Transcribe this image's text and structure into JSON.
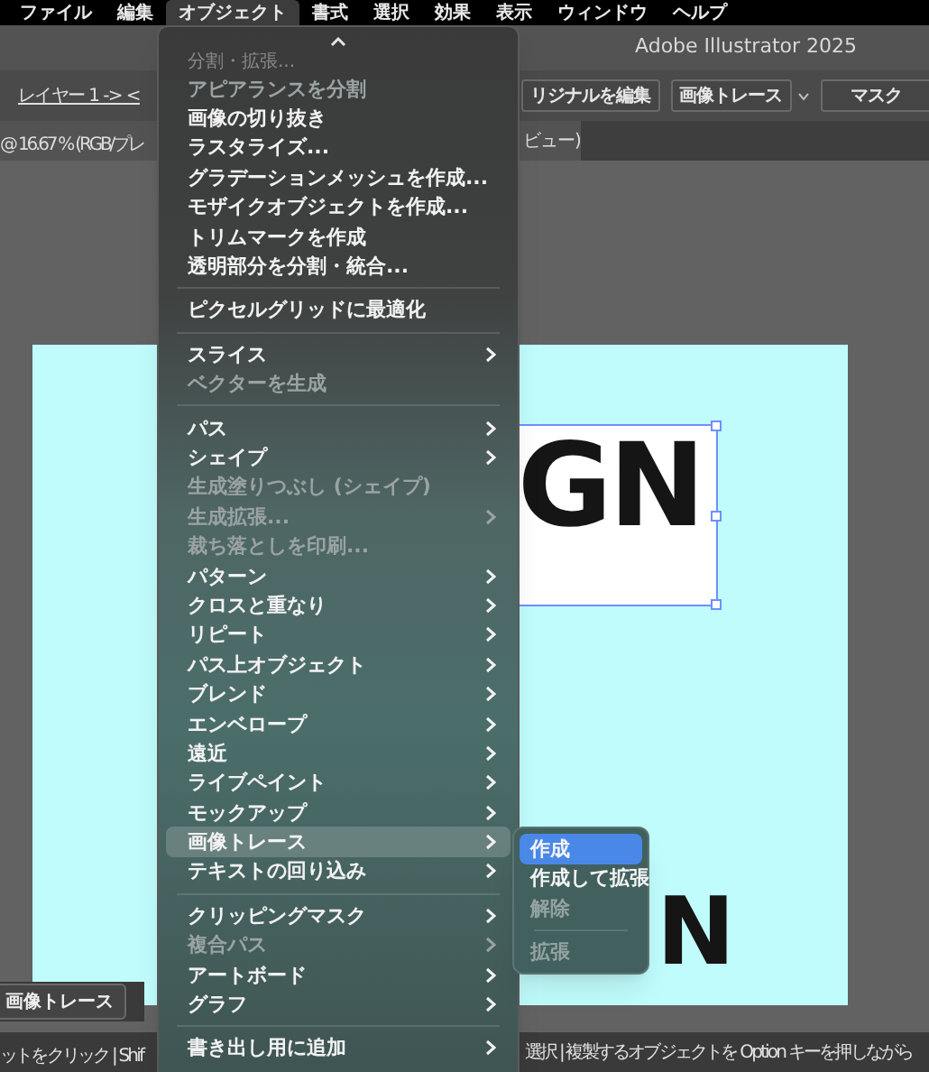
{
  "menu_bar": [
    {
      "label": "ファイル",
      "selected": false
    },
    {
      "label": "編集",
      "selected": false
    },
    {
      "label": "オブジェクト",
      "selected": true
    },
    {
      "label": "書式",
      "selected": false
    },
    {
      "label": "選択",
      "selected": false
    },
    {
      "label": "効果",
      "selected": false
    },
    {
      "label": "表示",
      "selected": false
    },
    {
      "label": "ウィンドウ",
      "selected": false
    },
    {
      "label": "ヘルプ",
      "selected": false
    }
  ],
  "app_title": "Adobe Illustrator 2025",
  "control_bar": {
    "breadcrumb": "レイヤー 1 -> <",
    "buttons": [
      {
        "kind": "button",
        "label": "リジナルを編集"
      },
      {
        "kind": "dropdown",
        "label": "画像トレース"
      },
      {
        "kind": "button",
        "label": "マスク"
      }
    ]
  },
  "document_tab": {
    "left_text": "@ 16.67 % (RGB/プレ",
    "right_text": "ビュー)"
  },
  "artboard": {
    "image_text": "GN",
    "lower_text": "N"
  },
  "floating_bar": {
    "button": "画像トレース"
  },
  "status_bar": {
    "left": "ットをクリック | Shif",
    "right": "選択 | 複製するオブジェクトを Option キーを押しながら"
  },
  "menu": {
    "items": [
      {
        "kind": "clipped",
        "label": "分割・拡張..."
      },
      {
        "kind": "item",
        "label": "アピアランスを分割",
        "disabled": true,
        "submenu": false,
        "selected": false
      },
      {
        "kind": "item",
        "label": "画像の切り抜き",
        "disabled": false,
        "submenu": false,
        "selected": false
      },
      {
        "kind": "item",
        "label": "ラスタライズ...",
        "disabled": false,
        "submenu": false,
        "selected": false
      },
      {
        "kind": "item",
        "label": "グラデーションメッシュを作成...",
        "disabled": false,
        "submenu": false,
        "selected": false
      },
      {
        "kind": "item",
        "label": "モザイクオブジェクトを作成...",
        "disabled": false,
        "submenu": false,
        "selected": false
      },
      {
        "kind": "item",
        "label": "トリムマークを作成",
        "disabled": false,
        "submenu": false,
        "selected": false
      },
      {
        "kind": "item",
        "label": "透明部分を分割・統合...",
        "disabled": false,
        "submenu": false,
        "selected": false
      },
      {
        "kind": "separator"
      },
      {
        "kind": "item",
        "label": "ピクセルグリッドに最適化",
        "disabled": false,
        "submenu": false,
        "selected": false
      },
      {
        "kind": "separator"
      },
      {
        "kind": "item",
        "label": "スライス",
        "disabled": false,
        "submenu": true,
        "selected": false
      },
      {
        "kind": "item",
        "label": "ベクターを生成",
        "disabled": true,
        "submenu": false,
        "selected": false
      },
      {
        "kind": "separator"
      },
      {
        "kind": "item",
        "label": "パス",
        "disabled": false,
        "submenu": true,
        "selected": false
      },
      {
        "kind": "item",
        "label": "シェイプ",
        "disabled": false,
        "submenu": true,
        "selected": false
      },
      {
        "kind": "item",
        "label": "生成塗りつぶし (シェイプ)",
        "disabled": true,
        "submenu": false,
        "selected": false
      },
      {
        "kind": "item",
        "label": "生成拡張...",
        "disabled": true,
        "submenu": true,
        "selected": false
      },
      {
        "kind": "item",
        "label": "裁ち落としを印刷...",
        "disabled": true,
        "submenu": false,
        "selected": false
      },
      {
        "kind": "item",
        "label": "パターン",
        "disabled": false,
        "submenu": true,
        "selected": false
      },
      {
        "kind": "item",
        "label": "クロスと重なり",
        "disabled": false,
        "submenu": true,
        "selected": false
      },
      {
        "kind": "item",
        "label": "リピート",
        "disabled": false,
        "submenu": true,
        "selected": false
      },
      {
        "kind": "item",
        "label": "パス上オブジェクト",
        "disabled": false,
        "submenu": true,
        "selected": false
      },
      {
        "kind": "item",
        "label": "ブレンド",
        "disabled": false,
        "submenu": true,
        "selected": false
      },
      {
        "kind": "item",
        "label": "エンベロープ",
        "disabled": false,
        "submenu": true,
        "selected": false
      },
      {
        "kind": "item",
        "label": "遠近",
        "disabled": false,
        "submenu": true,
        "selected": false
      },
      {
        "kind": "item",
        "label": "ライブペイント",
        "disabled": false,
        "submenu": true,
        "selected": false
      },
      {
        "kind": "item",
        "label": "モックアップ",
        "disabled": false,
        "submenu": true,
        "selected": false
      },
      {
        "kind": "item",
        "label": "画像トレース",
        "disabled": false,
        "submenu": true,
        "selected": true
      },
      {
        "kind": "item",
        "label": "テキストの回り込み",
        "disabled": false,
        "submenu": true,
        "selected": false
      },
      {
        "kind": "separator"
      },
      {
        "kind": "item",
        "label": "クリッピングマスク",
        "disabled": false,
        "submenu": true,
        "selected": false
      },
      {
        "kind": "item",
        "label": "複合パス",
        "disabled": true,
        "submenu": true,
        "selected": false
      },
      {
        "kind": "item",
        "label": "アートボード",
        "disabled": false,
        "submenu": true,
        "selected": false
      },
      {
        "kind": "item",
        "label": "グラフ",
        "disabled": false,
        "submenu": true,
        "selected": false
      },
      {
        "kind": "separator"
      },
      {
        "kind": "item",
        "label": "書き出し用に追加",
        "disabled": false,
        "submenu": true,
        "selected": false
      }
    ]
  },
  "submenu": {
    "items": [
      {
        "kind": "item",
        "label": "作成",
        "disabled": false,
        "selected": true
      },
      {
        "kind": "item",
        "label": "作成して拡張",
        "disabled": false,
        "selected": false
      },
      {
        "kind": "item",
        "label": "解除",
        "disabled": true,
        "selected": false
      },
      {
        "kind": "separator"
      },
      {
        "kind": "item",
        "label": "拡張",
        "disabled": true,
        "selected": false
      }
    ]
  }
}
